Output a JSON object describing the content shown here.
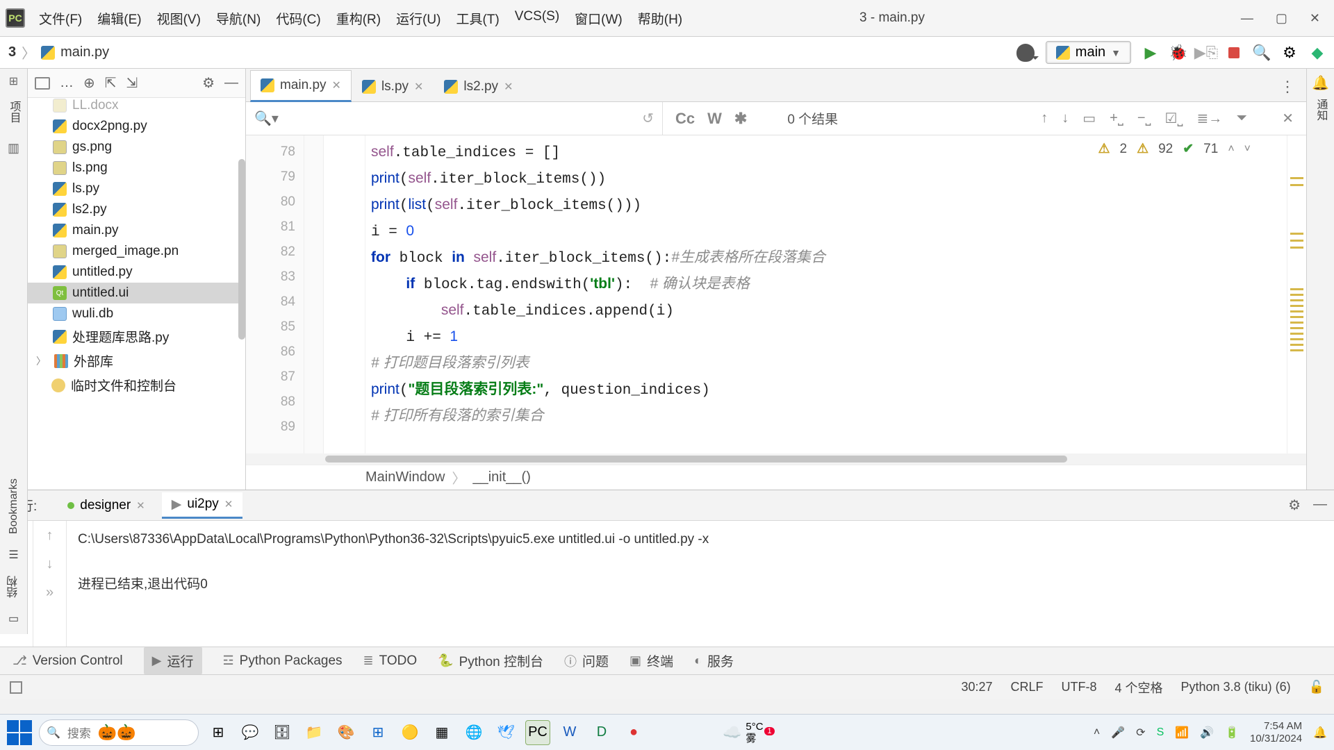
{
  "window": {
    "title": "3 - main.py"
  },
  "menus": [
    "文件(F)",
    "编辑(E)",
    "视图(V)",
    "导航(N)",
    "代码(C)",
    "重构(R)",
    "运行(U)",
    "工具(T)",
    "VCS(S)",
    "窗口(W)",
    "帮助(H)"
  ],
  "breadcrumb": {
    "project": "3",
    "file": "main.py"
  },
  "runcfg": {
    "label": "main"
  },
  "leftstrip": {
    "project": "项目"
  },
  "leftstrip2": {
    "bookmarks": "Bookmarks",
    "structure": "结构"
  },
  "rightstrip": {
    "notify": "通知"
  },
  "tree": {
    "items": [
      {
        "icon": "img",
        "name": "LL.docx",
        "cut": true
      },
      {
        "icon": "py",
        "name": "docx2png.py"
      },
      {
        "icon": "img",
        "name": "gs.png"
      },
      {
        "icon": "img",
        "name": "ls.png"
      },
      {
        "icon": "py",
        "name": "ls.py"
      },
      {
        "icon": "py",
        "name": "ls2.py"
      },
      {
        "icon": "py",
        "name": "main.py"
      },
      {
        "icon": "img",
        "name": "merged_image.pn"
      },
      {
        "icon": "py",
        "name": "untitled.py"
      },
      {
        "icon": "ui",
        "name": "untitled.ui",
        "selected": true
      },
      {
        "icon": "db",
        "name": "wuli.db"
      },
      {
        "icon": "py",
        "name": "处理题库思路.py"
      }
    ],
    "ext_lib": "外部库",
    "scratch": "临时文件和控制台"
  },
  "tabs": [
    {
      "name": "main.py",
      "active": true
    },
    {
      "name": "ls.py"
    },
    {
      "name": "ls2.py"
    }
  ],
  "find": {
    "results": "0 个结果",
    "cc": "Cc",
    "w": "W",
    "regex": "✱"
  },
  "inspect": {
    "warn1": "2",
    "warn2": "92",
    "ok": "71"
  },
  "gutter": [
    "78",
    "79",
    "80",
    "81",
    "82",
    "83",
    "84",
    "85",
    "86",
    "87",
    "88",
    "89"
  ],
  "code": {
    "l78": "self.table_indices = []",
    "l79": "print(self.iter_block_items())",
    "l80": "print(list(self.iter_block_items()))",
    "l81": "i = 0",
    "l82_pre": "for block in self.iter_block_items():",
    "l82_cm": "#生成表格所在段落集合",
    "l83_pre": "if block.tag.endswith('tbl'):  ",
    "l83_cm": "# 确认块是表格",
    "l84": "self.table_indices.append(i)",
    "l85": "i += 1",
    "l86_cm": "# 打印题目段落索引列表",
    "l87_pre": "print(",
    "l87_str": "\"题目段落索引列表:\"",
    "l87_post": ", question_indices)",
    "l88_cm": "# 打印所有段落的索引集合"
  },
  "breadcode": {
    "a": "MainWindow",
    "b": "__init__()"
  },
  "run": {
    "label": "运行:",
    "tabs": [
      {
        "name": "designer"
      },
      {
        "name": "ui2py",
        "active": true
      }
    ],
    "out_cmd": "C:\\Users\\87336\\AppData\\Local\\Programs\\Python\\Python36-32\\Scripts\\pyuic5.exe untitled.ui -o untitled.py -x",
    "out_end": "进程已结束,退出代码0"
  },
  "bottom": {
    "vc": "Version Control",
    "run": "运行",
    "pkg": "Python Packages",
    "todo": "TODO",
    "console": "Python 控制台",
    "problems": "问题",
    "term": "终端",
    "services": "服务"
  },
  "status": {
    "pos": "30:27",
    "eol": "CRLF",
    "enc": "UTF-8",
    "indent": "4 个空格",
    "interp": "Python 3.8 (tiku) (6)"
  },
  "taskbar": {
    "search": "搜索",
    "weather_temp": "5°C",
    "weather_txt": "雾",
    "time": "7:54 AM",
    "date": "10/31/2024"
  }
}
